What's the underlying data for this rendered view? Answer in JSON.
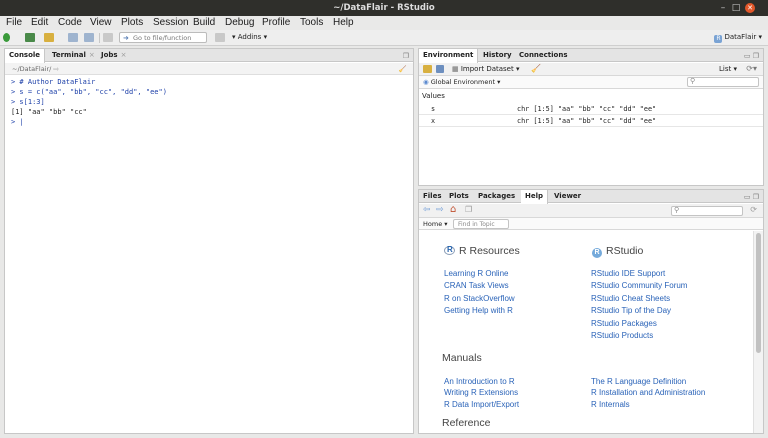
{
  "window": {
    "title": "~/DataFlair - RStudio"
  },
  "menu": [
    "File",
    "Edit",
    "Code",
    "View",
    "Plots",
    "Session",
    "Build",
    "Debug",
    "Profile",
    "Tools",
    "Help"
  ],
  "toolbar": {
    "goto_placeholder": "Go to file/function",
    "addins_label": "Addins",
    "project_label": "DataFlair"
  },
  "left_pane": {
    "tabs": [
      "Console",
      "Terminal",
      "Jobs"
    ],
    "path": "~/DataFlair/",
    "console_lines": [
      {
        "kind": "cmd",
        "text": "> # Author DataFlair"
      },
      {
        "kind": "cmd",
        "text": "> s = c(\"aa\", \"bb\", \"cc\", \"dd\", \"ee\")"
      },
      {
        "kind": "cmd",
        "text": "> s[1:3]"
      },
      {
        "kind": "out",
        "text": "[1] \"aa\" \"bb\" \"cc\""
      },
      {
        "kind": "cmd",
        "text": "> |"
      }
    ]
  },
  "env_pane": {
    "tabs": [
      "Environment",
      "History",
      "Connections"
    ],
    "import_label": "Import Dataset",
    "list_label": "List",
    "scope_label": "Global Environment",
    "section": "Values",
    "rows": [
      {
        "name": "s",
        "value": "chr [1:5] \"aa\" \"bb\" \"cc\" \"dd\" \"ee\""
      },
      {
        "name": "x",
        "value": "chr [1:5] \"aa\" \"bb\" \"cc\" \"dd\" \"ee\""
      }
    ]
  },
  "help_pane": {
    "tabs": [
      "Files",
      "Plots",
      "Packages",
      "Help",
      "Viewer"
    ],
    "home_label": "Home",
    "find_placeholder": "Find in Topic",
    "r_resources": {
      "heading": "R Resources",
      "links": [
        "Learning R Online",
        "CRAN Task Views",
        "R on StackOverflow",
        "Getting Help with R"
      ]
    },
    "rstudio": {
      "heading": "RStudio",
      "links": [
        "RStudio IDE Support",
        "RStudio Community Forum",
        "RStudio Cheat Sheets",
        "RStudio Tip of the Day",
        "RStudio Packages",
        "RStudio Products"
      ]
    },
    "manuals": {
      "heading": "Manuals",
      "left_links": [
        "An Introduction to R",
        "Writing R Extensions",
        "R Data Import/Export"
      ],
      "right_links": [
        "The R Language Definition",
        "R Installation and Administration",
        "R Internals"
      ]
    },
    "reference_heading": "Reference"
  }
}
